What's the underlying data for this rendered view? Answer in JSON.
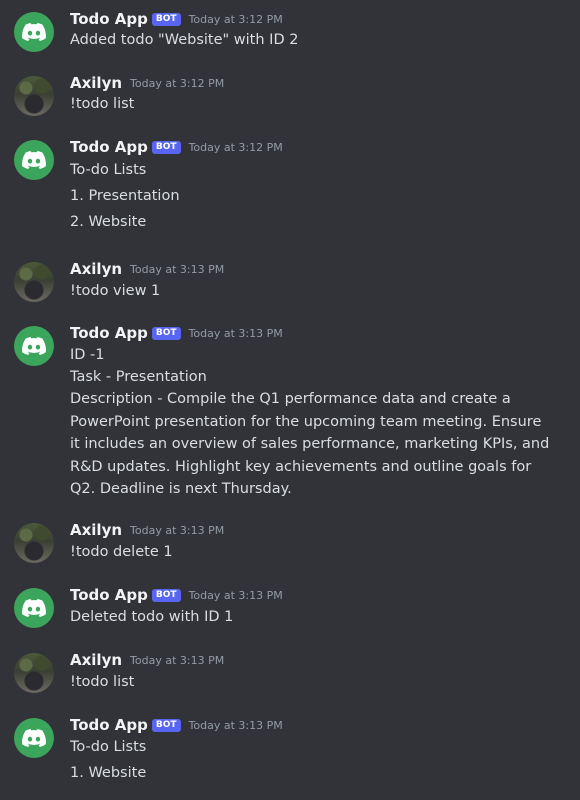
{
  "colors": {
    "background": "#313338",
    "text": "#dbdee1",
    "username": "#f2f3f5",
    "timestamp": "#949ba4",
    "bot_tag": "#5865f2",
    "bot_avatar": "#3ba55c"
  },
  "bot_tag_label": "BOT",
  "messages": [
    {
      "author": "Todo App",
      "bot": true,
      "time": "Today at 3:12 PM",
      "lines": [
        "Added todo \"Website\" with ID 2"
      ]
    },
    {
      "author": "Axilyn",
      "bot": false,
      "time": "Today at 3:12 PM",
      "lines": [
        "!todo list"
      ]
    },
    {
      "author": "Todo App",
      "bot": true,
      "time": "Today at 3:12 PM",
      "lines": [
        "To-do Lists",
        "1. Presentation",
        "2. Website"
      ]
    },
    {
      "author": "Axilyn",
      "bot": false,
      "time": "Today at 3:13 PM",
      "lines": [
        "!todo view 1"
      ]
    },
    {
      "author": "Todo App",
      "bot": true,
      "time": "Today at 3:13 PM",
      "lines": [
        "ID -1",
        "Task - Presentation"
      ],
      "description": "Description - Compile the Q1 performance data and create a PowerPoint presentation for the upcoming team meeting. Ensure it includes an overview of sales performance, marketing KPIs, and R&D updates. Highlight key achievements and outline goals for Q2. Deadline is next Thursday."
    },
    {
      "author": "Axilyn",
      "bot": false,
      "time": "Today at 3:13 PM",
      "lines": [
        "!todo delete 1"
      ]
    },
    {
      "author": "Todo App",
      "bot": true,
      "time": "Today at 3:13 PM",
      "lines": [
        "Deleted todo with ID 1"
      ]
    },
    {
      "author": "Axilyn",
      "bot": false,
      "time": "Today at 3:13 PM",
      "lines": [
        "!todo list"
      ]
    },
    {
      "author": "Todo App",
      "bot": true,
      "time": "Today at 3:13 PM",
      "lines": [
        "To-do Lists",
        "1. Website"
      ]
    }
  ]
}
